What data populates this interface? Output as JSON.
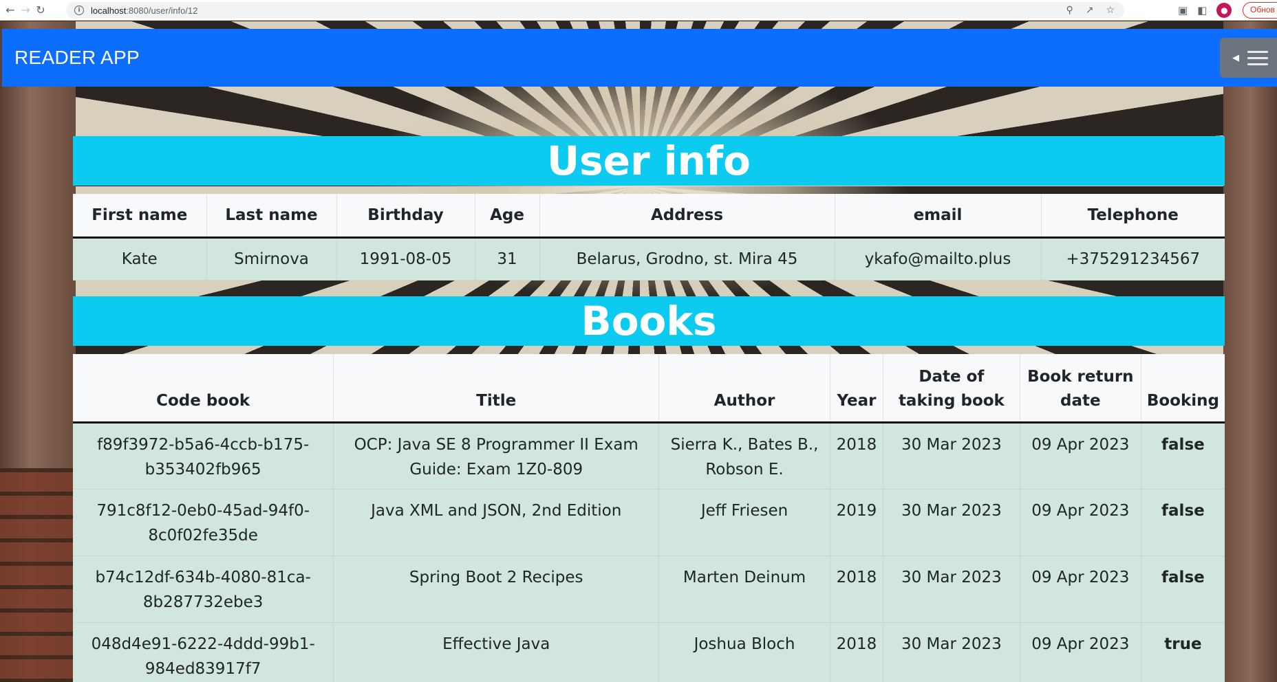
{
  "browser": {
    "url_host": "localhost",
    "url_path": ":8080/user/info/12",
    "update_label": "Обнов"
  },
  "navbar": {
    "brand": "READER APP"
  },
  "user_section": {
    "title": "User info",
    "headers": [
      "First name",
      "Last name",
      "Birthday",
      "Age",
      "Address",
      "email",
      "Telephone"
    ],
    "row": [
      "Kate",
      "Smirnova",
      "1991-08-05",
      "31",
      "Belarus, Grodno, st. Mira 45",
      "ykafo@mailto.plus",
      "+375291234567"
    ]
  },
  "books_section": {
    "title": "Books",
    "headers": [
      "Code book",
      "Title",
      "Author",
      "Year",
      "Date of taking book",
      "Book return date",
      "Booking"
    ],
    "rows": [
      [
        "f89f3972-b5a6-4ccb-b175-b353402fb965",
        "OCP: Java SE 8 Programmer II Exam Guide: Exam 1Z0-809",
        "Sierra K., Bates B., Robson E.",
        "2018",
        "30 Mar 2023",
        "09 Apr 2023",
        "false"
      ],
      [
        "791c8f12-0eb0-45ad-94f0-8c0f02fe35de",
        "Java XML and JSON, 2nd Edition",
        "Jeff Friesen",
        "2019",
        "30 Mar 2023",
        "09 Apr 2023",
        "false"
      ],
      [
        "b74c12df-634b-4080-81ca-8b287732ebe3",
        "Spring Boot 2 Recipes",
        "Marten Deinum",
        "2018",
        "30 Mar 2023",
        "09 Apr 2023",
        "false"
      ],
      [
        "048d4e91-6222-4ddd-99b1-984ed83917f7",
        "Effective Java",
        "Joshua Bloch",
        "2018",
        "30 Mar 2023",
        "09 Apr 2023",
        "true"
      ]
    ]
  }
}
